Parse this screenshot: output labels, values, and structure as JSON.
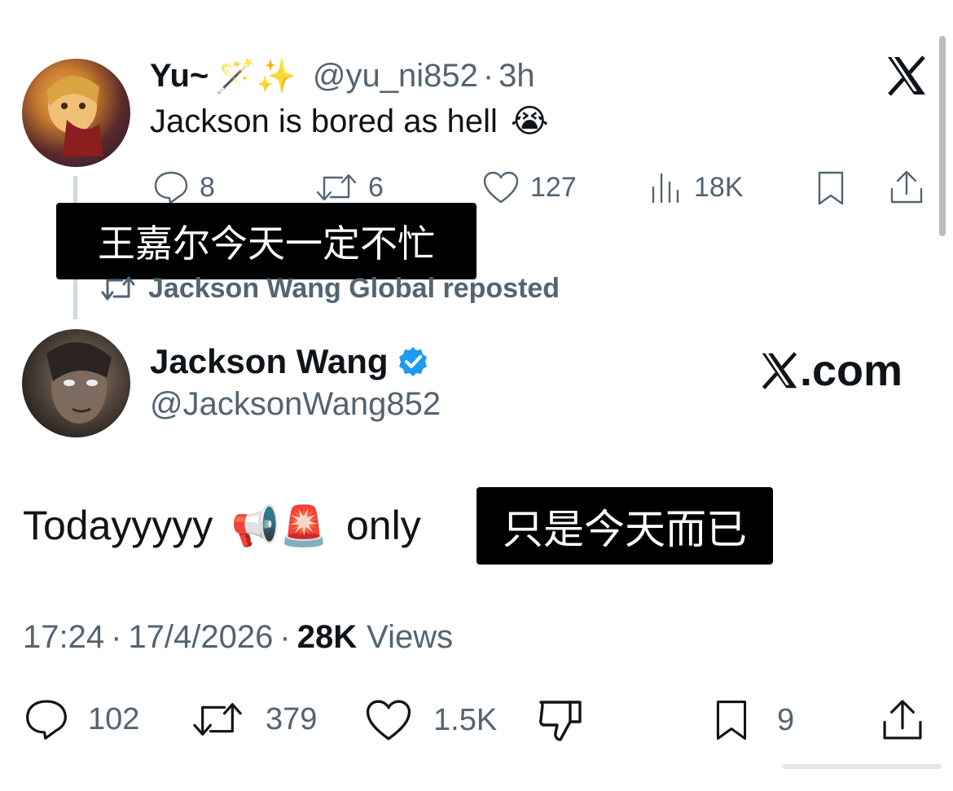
{
  "reply_tweet": {
    "display_name": "Yu~",
    "name_emojis": "🪄✨",
    "handle": "@yu_ni852",
    "separator": "·",
    "time": "3h",
    "text": "Jackson is bored as hell",
    "text_emoji": "😭",
    "stats": {
      "replies": "8",
      "reposts": "6",
      "likes": "127",
      "views": "18K"
    }
  },
  "overlay_top": "王嘉尔今天一定不忙",
  "repost_banner": "Jackson Wang Global reposted",
  "main_tweet": {
    "display_name": "Jackson Wang",
    "handle": "@JacksonWang852",
    "text": "Todayyyyy",
    "text_emojis": "📢🚨",
    "text_tail": "only",
    "time": "17:24",
    "date": "17/4/2026",
    "views_count": "28K",
    "views_label": "Views",
    "stats": {
      "replies": "102",
      "reposts": "379",
      "likes": "1.5K",
      "bookmarks": "9"
    }
  },
  "overlay_main": "只是今天而已",
  "brand": {
    "logo_glyph": "𝕏",
    "domain": ".com"
  },
  "colors": {
    "verified": "#1d9bf0",
    "text": "#0f1419",
    "muted": "#536471",
    "overlay_bg": "#000000"
  }
}
